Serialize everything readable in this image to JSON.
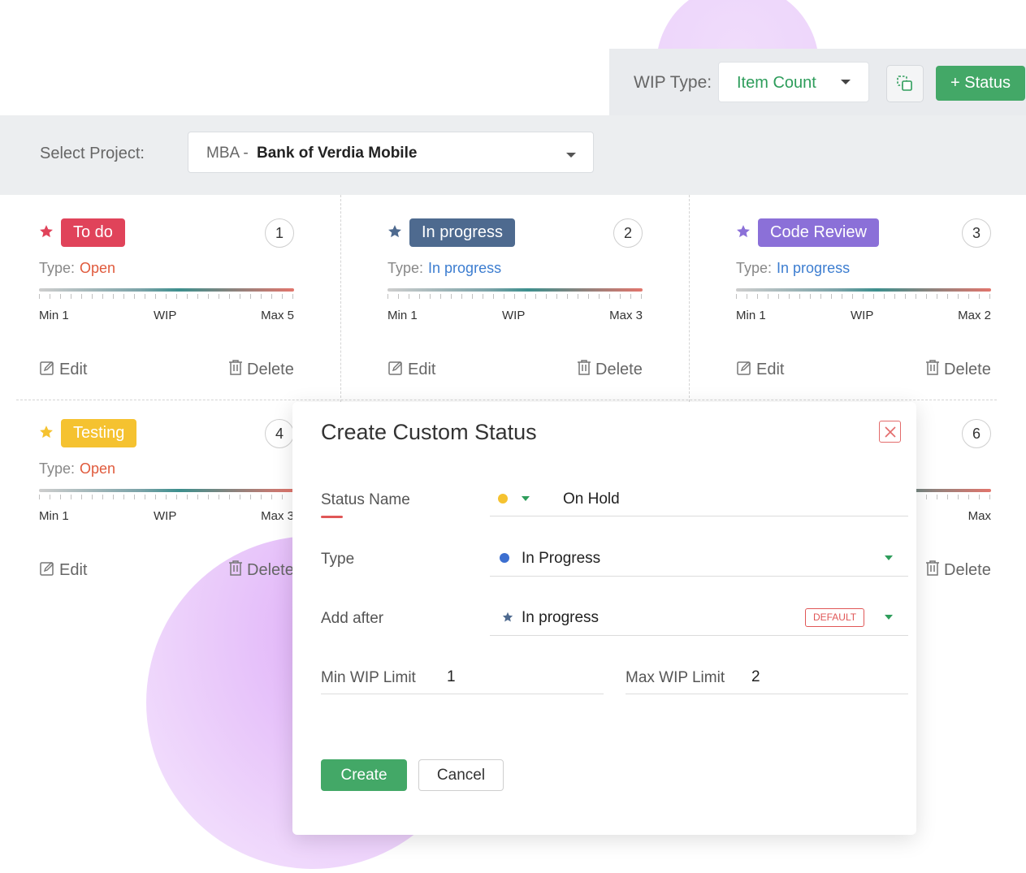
{
  "toolbar": {
    "wip_type_label": "WIP Type:",
    "wip_type_value": "Item Count",
    "add_status_label": "+ Status"
  },
  "project": {
    "label": "Select Project:",
    "code": "MBA -",
    "name": "Bank of Verdia Mobile"
  },
  "cards": [
    {
      "name": "To do",
      "color": "#e0435a",
      "number": "1",
      "type_label": "Type:",
      "type_value": "Open",
      "type_color": "#e05a3c",
      "min": "Min 1",
      "wip": "WIP",
      "max": "Max 5",
      "edit": "Edit",
      "delete": "Delete"
    },
    {
      "name": "In progress",
      "color": "#4e6a8f",
      "number": "2",
      "type_label": "Type:",
      "type_value": "In progress",
      "type_color": "#3c7dd0",
      "min": "Min 1",
      "wip": "WIP",
      "max": "Max 3",
      "edit": "Edit",
      "delete": "Delete"
    },
    {
      "name": "Code Review",
      "color": "#8b70d8",
      "number": "3",
      "type_label": "Type:",
      "type_value": "In progress",
      "type_color": "#3c7dd0",
      "min": "Min 1",
      "wip": "WIP",
      "max": "Max 2",
      "edit": "Edit",
      "delete": "Delete"
    },
    {
      "name": "Testing",
      "color": "#f5c230",
      "number": "4",
      "type_label": "Type:",
      "type_value": "Open",
      "type_color": "#e05a3c",
      "min": "Min 1",
      "wip": "WIP",
      "max": "Max 3",
      "edit": "Edit",
      "delete": "Delete"
    },
    {
      "number": "6",
      "max": "Max",
      "delete": "Delete"
    }
  ],
  "modal": {
    "title": "Create Custom Status",
    "status_name_label": "Status Name",
    "status_name_value": "On Hold",
    "status_color": "#f5c230",
    "type_label": "Type",
    "type_value": "In Progress",
    "type_color": "#3c6fd0",
    "add_after_label": "Add after",
    "add_after_value": "In progress",
    "add_after_badge": "DEFAULT",
    "min_wip_label": "Min WIP Limit",
    "min_wip_value": "1",
    "max_wip_label": "Max WIP Limit",
    "max_wip_value": "2",
    "create_label": "Create",
    "cancel_label": "Cancel"
  }
}
